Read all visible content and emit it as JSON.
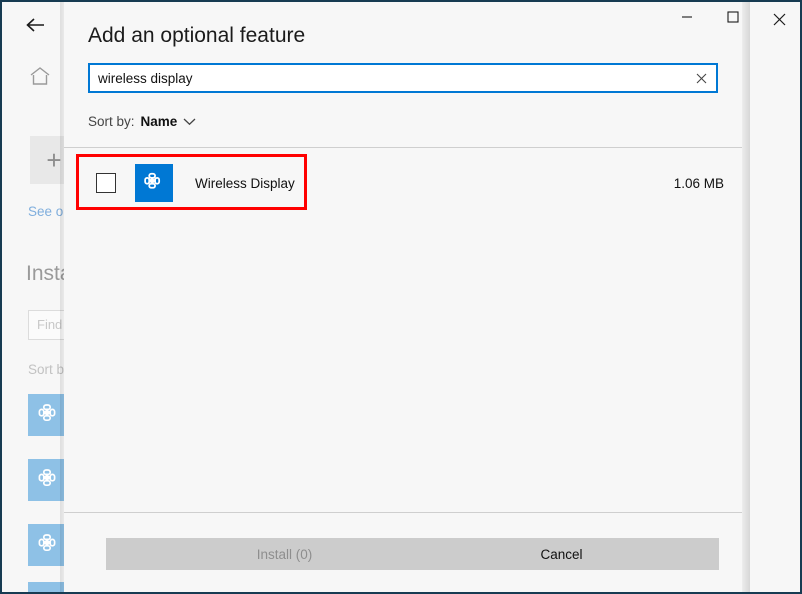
{
  "window": {
    "close_icon": "close-icon"
  },
  "background_page": {
    "back_icon": "back-arrow-icon",
    "home_icon": "home-icon",
    "add_button_icon": "plus-icon",
    "see_optional_link": "See op",
    "installed_heading": "Insta",
    "find_placeholder": "Find",
    "sort_label": "Sort b",
    "tiles": [
      {
        "icon": "puzzle-piece-icon"
      },
      {
        "icon": "puzzle-piece-icon"
      },
      {
        "icon": "puzzle-piece-icon"
      },
      {
        "icon": "puzzle-piece-icon"
      }
    ]
  },
  "dialog": {
    "title": "Add an optional feature",
    "minimize_label": "—",
    "maximize_label": "☐",
    "search": {
      "value": "wireless display",
      "placeholder": "",
      "clear_icon": "close-icon"
    },
    "sort": {
      "label": "Sort by:",
      "value": "Name",
      "chevron_icon": "chevron-down-icon"
    },
    "features": [
      {
        "name": "Wireless Display",
        "size": "1.06 MB",
        "checked": false,
        "icon": "puzzle-piece-icon"
      }
    ],
    "footer": {
      "install_label": "Install (0)",
      "install_enabled": false,
      "cancel_label": "Cancel",
      "cancel_enabled": true
    }
  },
  "annotation": {
    "highlight_color": "#ff0000"
  }
}
